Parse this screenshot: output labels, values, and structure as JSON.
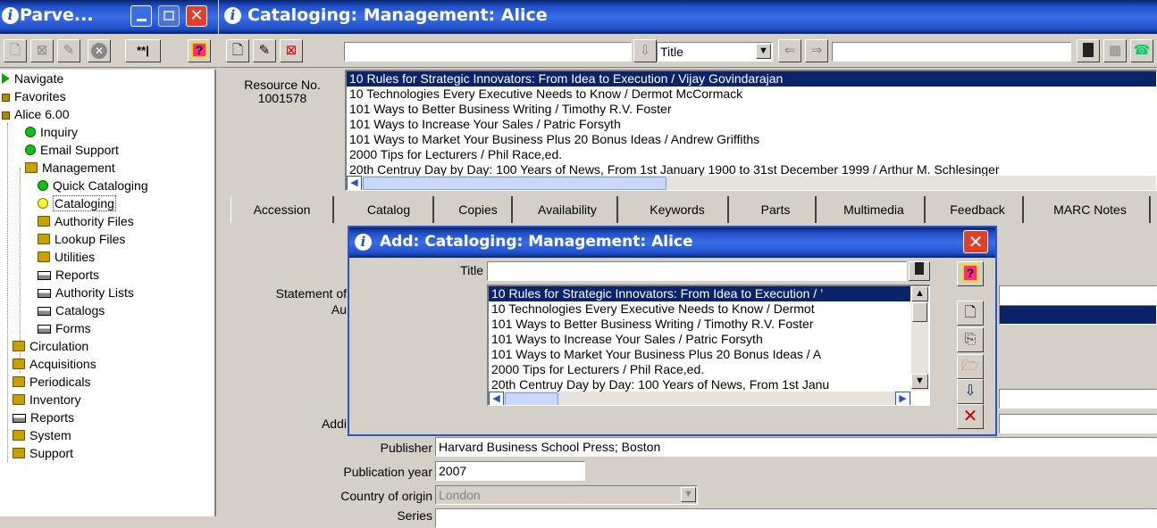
{
  "left_window": {
    "title": "Parve...",
    "toolbar_icons": [
      "new-icon",
      "delete-icon",
      "edit-icon",
      "cancel-icon",
      "keyword-icon",
      "help-icon"
    ]
  },
  "main_window": {
    "title": "Cataloging: Management: Alice",
    "search": {
      "field_selected": "Title",
      "value": ""
    }
  },
  "tree": [
    {
      "label": "Navigate",
      "icon": "arrow-icon"
    },
    {
      "label": "Favorites",
      "icon": "book-icon"
    },
    {
      "label": "Alice 6.00",
      "icon": "book-icon"
    },
    {
      "label": "Inquiry",
      "icon": "green-dot-icon"
    },
    {
      "label": "Email Support",
      "icon": "green-dot-icon"
    },
    {
      "label": "Management",
      "icon": "folder-icon"
    },
    {
      "label": "Quick Cataloging",
      "icon": "green-dot-icon"
    },
    {
      "label": "Cataloging",
      "icon": "yellow-dot-icon"
    },
    {
      "label": "Authority Files",
      "icon": "folder-icon"
    },
    {
      "label": "Lookup Files",
      "icon": "folder-icon"
    },
    {
      "label": "Utilities",
      "icon": "folder-icon"
    },
    {
      "label": "Reports",
      "icon": "printer-icon"
    },
    {
      "label": "Authority Lists",
      "icon": "printer-icon"
    },
    {
      "label": "Catalogs",
      "icon": "printer-icon"
    },
    {
      "label": "Forms",
      "icon": "printer-icon"
    },
    {
      "label": "Circulation",
      "icon": "folder-icon"
    },
    {
      "label": "Acquisitions",
      "icon": "folder-icon"
    },
    {
      "label": "Periodicals",
      "icon": "folder-icon"
    },
    {
      "label": "Inventory",
      "icon": "folder-icon"
    },
    {
      "label": "Reports",
      "icon": "printer-icon"
    },
    {
      "label": "System",
      "icon": "folder-icon"
    },
    {
      "label": "Support",
      "icon": "folder-icon"
    }
  ],
  "resource": {
    "label": "Resource No.",
    "number": "1001578"
  },
  "results": [
    "10 Rules for Strategic Innovators: From Idea to Execution / Vijay Govindarajan",
    "10 Technologies Every Executive Needs to Know / Dermot McCormack",
    "101 Ways to Better Business Writing / Timothy R.V. Foster",
    "101 Ways to Increase Your Sales / Patric Forsyth",
    "101 Ways to Market Your Business Plus 20 Bonus Ideas / Andrew Griffiths",
    "2000 Tips for Lecturers / Phil Race,ed.",
    "20th Centruy Day by Day: 100 Years of News, From 1st January 1900 to 31st December 1999 / Arthur M. Schlesinger"
  ],
  "tabs": [
    "Accession",
    "Catalog",
    "Copies",
    "Availability",
    "Keywords",
    "Parts",
    "Multimedia",
    "Feedback",
    "MARC Notes"
  ],
  "form": {
    "statement_label": "Statement of",
    "author_label": "Au",
    "additional_label": "Addi",
    "publisher_label": "Publisher",
    "publisher_value": "Harvard Business School Press; Boston",
    "pubyear_label": "Publication year",
    "pubyear_value": "2007",
    "country_label": "Country of origin",
    "country_value": "London",
    "series_label": "Series"
  },
  "dialog": {
    "title": "Add: Cataloging: Management: Alice",
    "title_label": "Title",
    "title_value": "",
    "results": [
      "10 Rules for Strategic Innovators: From Idea to Execution / ’",
      "10 Technologies Every Executive Needs to Know / Dermot",
      "101 Ways to Better Business Writing / Timothy R.V. Foster",
      "101 Ways to Increase Your Sales / Patric Forsyth",
      "101 Ways to Market Your Business Plus 20 Bonus Ideas / A",
      "2000 Tips for Lecturers / Phil Race,ed.",
      "20th Centruy Day by Day: 100 Years of News, From 1st Janu"
    ]
  },
  "colors": {
    "titlebar": "#1f4fc8",
    "selection": "#0a246a",
    "window_bg": "#d4d0c8",
    "close_red": "#e04028"
  }
}
